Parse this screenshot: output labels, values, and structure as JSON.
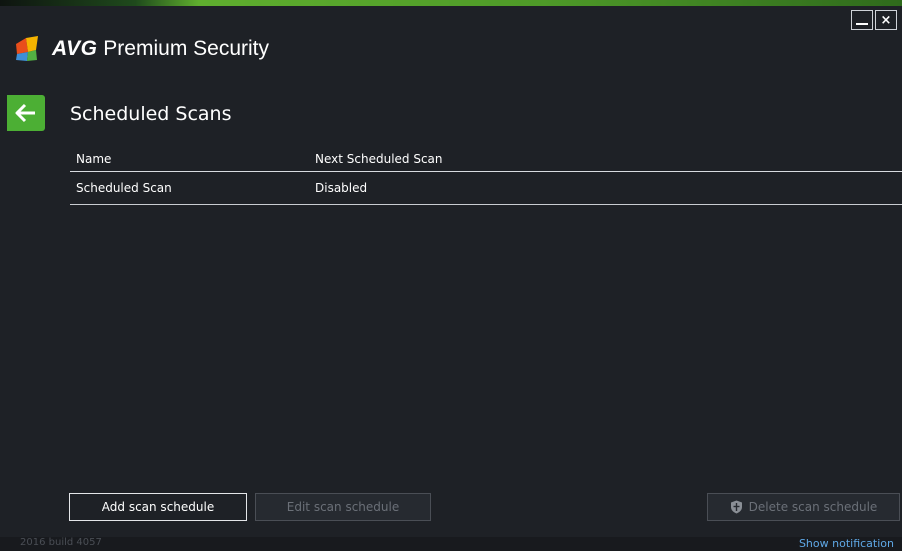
{
  "app": {
    "brand": "AVG",
    "product": "Premium Security"
  },
  "window": {
    "minimize_label": "",
    "close_label": "×"
  },
  "page": {
    "title": "Scheduled Scans"
  },
  "table": {
    "columns": [
      "Name",
      "Next Scheduled Scan"
    ],
    "rows": [
      {
        "name": "Scheduled Scan",
        "next": "Disabled"
      }
    ]
  },
  "buttons": {
    "add": "Add scan schedule",
    "edit": "Edit scan schedule",
    "delete": "Delete scan schedule"
  },
  "footer": {
    "build": "2016  build 4057",
    "notification": "Show notification"
  },
  "colors": {
    "accent": "#4caf34",
    "background": "#1e2126",
    "link": "#5fa8e6"
  },
  "icons": {
    "back": "arrow-left-icon",
    "logo": "avg-logo-icon",
    "delete": "shield-icon"
  }
}
